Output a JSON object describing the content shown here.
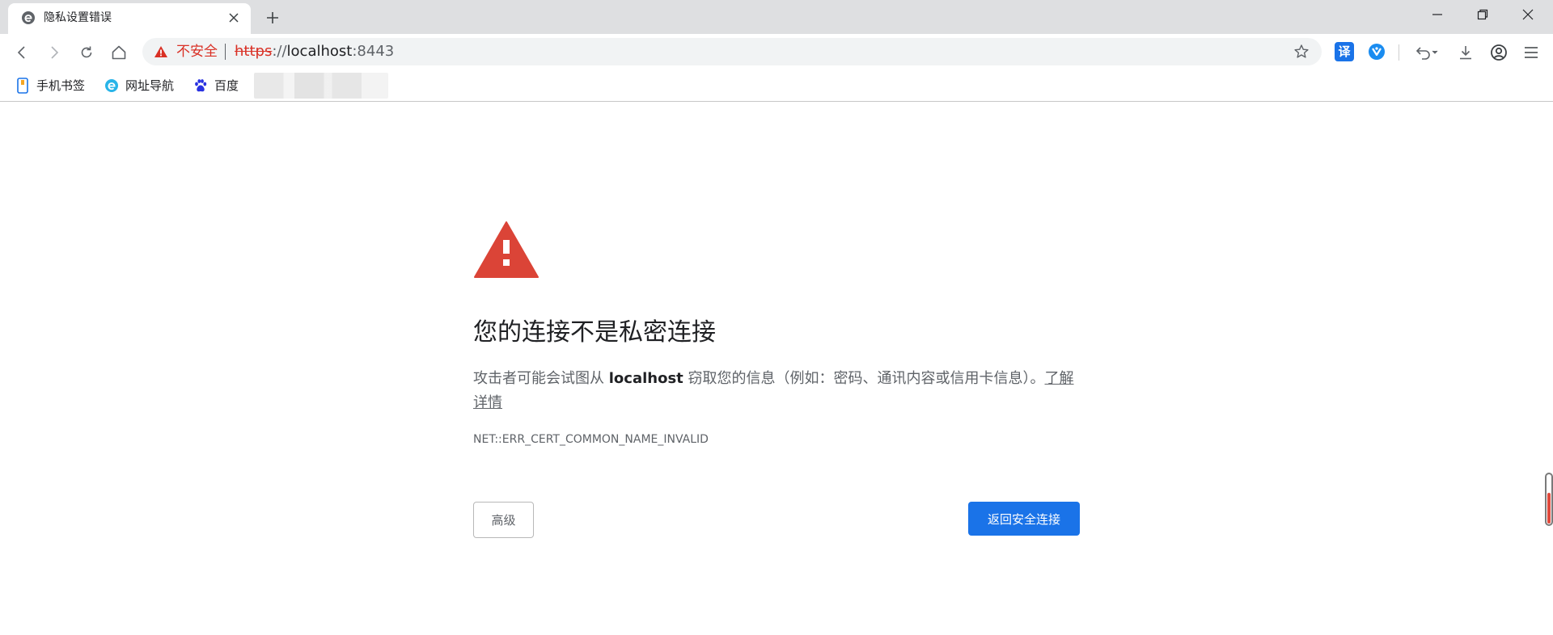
{
  "browser": {
    "tab": {
      "title": "隐私设置错误",
      "favicon": "browser-e-icon"
    },
    "window_controls": [
      "minimize-icon",
      "restore-icon",
      "close-icon"
    ],
    "toolbar": {
      "nav_icons": [
        "back-arrow-icon",
        "forward-arrow-icon",
        "reload-icon",
        "home-icon"
      ],
      "security_label": "不安全",
      "url_scheme": "https",
      "url_separator": "://",
      "url_host": "localhost",
      "url_port": ":8443",
      "extension_translate_label": "译",
      "right_icons": [
        "star-icon",
        "translate-icon",
        "shield-extension-icon",
        "undo-icon",
        "download-icon",
        "account-icon",
        "menu-icon"
      ]
    },
    "bookmarks": [
      {
        "label": "手机书签",
        "icon": "phone-bookmark-icon"
      },
      {
        "label": "网址导航",
        "icon": "nav-e-icon"
      },
      {
        "label": "百度",
        "icon": "baidu-paw-icon"
      }
    ]
  },
  "interstitial": {
    "headline": "您的连接不是私密连接",
    "message_before": "攻击者可能会试图从 ",
    "message_host": "localhost",
    "message_after": " 窃取您的信息（例如：密码、通讯内容或信用卡信息）。",
    "learn_more": "了解详情",
    "error_code": "NET::ERR_CERT_COMMON_NAME_INVALID",
    "advanced_button": "高级",
    "back_button": "返回安全连接"
  },
  "colors": {
    "danger": "#d93025",
    "warning_triangle": "#db4437",
    "primary_button": "#1a73e8",
    "tabstrip_bg": "#dedfe1",
    "omnibox_bg": "#f1f3f4"
  }
}
